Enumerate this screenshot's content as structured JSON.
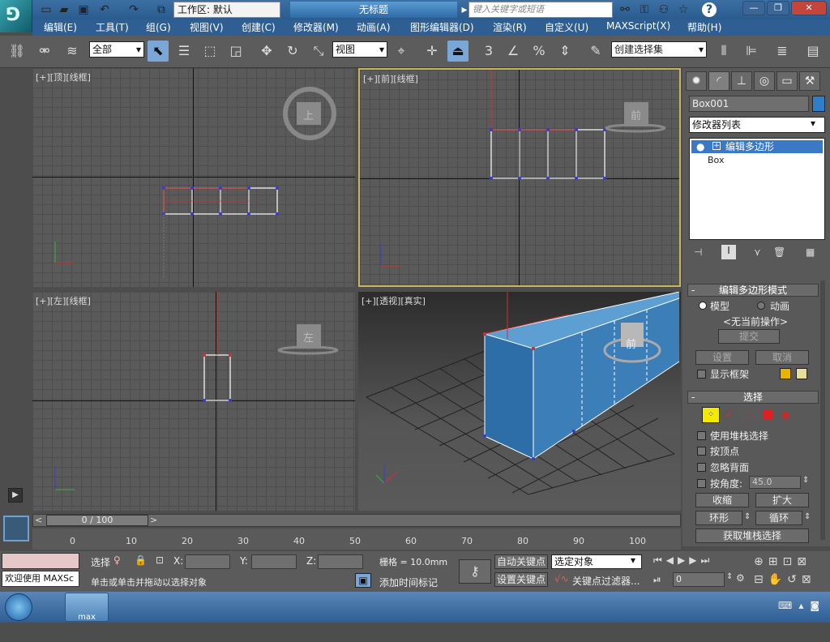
{
  "window": {
    "workspace_label": "工作区: 默认",
    "doc_title": "无标题",
    "search_placeholder": "键入关键字或短语",
    "help_label": "?"
  },
  "menu": [
    "编辑(E)",
    "工具(T)",
    "组(G)",
    "视图(V)",
    "创建(C)",
    "修改器(M)",
    "动画(A)",
    "图形编辑器(D)",
    "渲染(R)",
    "自定义(U)",
    "MAXScript(X)",
    "帮助(H)"
  ],
  "toolbar": {
    "filter_value": "全部",
    "refcoord_value": "视图",
    "selection_set_placeholder": "创建选择集",
    "snap_label": "3"
  },
  "viewports": {
    "top": {
      "label": "[+][顶][线框]",
      "cube_label": "上"
    },
    "front": {
      "label": "[+][前][线框]",
      "cube_label": "前"
    },
    "left": {
      "label": "[+][左][线框]",
      "cube_label": "左"
    },
    "perspective": {
      "label": "[+][透视][真实]",
      "cube_label": "前"
    }
  },
  "command_panel": {
    "object_name": "Box001",
    "object_color": "#2f7fc8",
    "modifier_list_label": "修改器列表",
    "stack": [
      {
        "label": "编辑多边形",
        "selected": true
      },
      {
        "label": "Box",
        "selected": false
      }
    ],
    "edit_poly_mode": {
      "header": "编辑多边形模式",
      "model_label": "模型",
      "animate_label": "动画",
      "no_current_op": "<无当前操作>",
      "commit_label": "提交",
      "settings_label": "设置",
      "cancel_label": "取消",
      "show_cage_label": "显示框架"
    },
    "selection": {
      "header": "选择",
      "use_stack_label": "使用堆栈选择",
      "by_vertex_label": "按顶点",
      "ignore_backfacing_label": "忽略背面",
      "by_angle_label": "按角度:",
      "by_angle_value": "45.0",
      "shrink_label": "收缩",
      "grow_label": "扩大",
      "ring_label": "环形",
      "loop_label": "循环",
      "get_stack_selection_label": "获取堆栈选择"
    }
  },
  "timeline": {
    "frame_display": "0 / 100",
    "ticks": [
      "0",
      "10",
      "20",
      "30",
      "40",
      "50",
      "60",
      "70",
      "80",
      "90",
      "100"
    ]
  },
  "status": {
    "selection_label": "选择",
    "x_label": "X:",
    "y_label": "Y:",
    "z_label": "Z:",
    "grid_label": "栅格 = 10.0mm",
    "auto_key_label": "自动关键点",
    "set_key_label": "设置关键点",
    "selected_object_value": "选定对象",
    "key_filters_label": "关键点过滤器...",
    "prompt_text": "单击或单击并拖动以选择对象",
    "add_time_tag_label": "添加时间标记",
    "welcome_text": "欢迎使用 MAXSc",
    "frame_value": "0"
  },
  "taskbar": {
    "app_label": "max"
  }
}
